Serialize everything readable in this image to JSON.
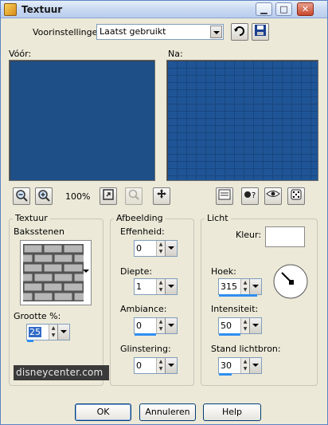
{
  "window": {
    "title": "Textuur"
  },
  "titlebar": {
    "minimize_glyph": "▁",
    "maximize_glyph": "□",
    "close_glyph": "✕"
  },
  "presets": {
    "label": "Voorinstellingen:",
    "value": "Laatst gebruikt"
  },
  "preview": {
    "before_label": "Vóór:",
    "after_label": "Na:",
    "zoom": "100%"
  },
  "texture": {
    "group_title": "Textuur",
    "name": "Baksstenen",
    "size_label": "Grootte %:",
    "size_value": "25"
  },
  "image": {
    "group_title": "Afbeelding",
    "fields": [
      {
        "label": "Effenheid:",
        "value": "0"
      },
      {
        "label": "Diepte:",
        "value": "1"
      },
      {
        "label": "Ambiance:",
        "value": "0"
      },
      {
        "label": "Glinstering:",
        "value": "0"
      }
    ]
  },
  "light": {
    "group_title": "Licht",
    "color_label": "Kleur:",
    "angle_label": "Hoek:",
    "angle_value": "315",
    "intensity_label": "Intensiteit:",
    "intensity_value": "50",
    "source_label": "Stand lichtbron:",
    "source_value": "30"
  },
  "watermark": "disneycenter.com",
  "buttons": {
    "ok": "OK",
    "cancel": "Annuleren",
    "help": "Help"
  },
  "colors": {
    "preview_blue": "#1e4f86",
    "accent": "#2f8ef0"
  }
}
